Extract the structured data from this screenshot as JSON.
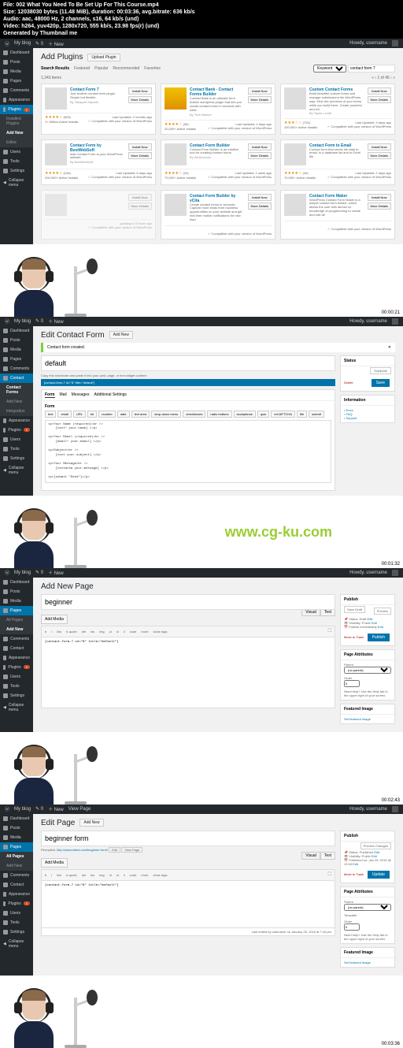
{
  "meta": {
    "line1": "File: 002 What You Need To Be Set Up For This Course.mp4",
    "line2": "Size: 12038030 bytes (11.48 MiB), duration: 00:03:36, avg.bitrate: 636 kb/s",
    "line3": "Audio: aac, 48000 Hz, 2 channels, s16, 64 kb/s (und)",
    "line4": "Video: h264, yuv420p, 1280x720, 555 kb/s, 23.98 fps(r) (und)",
    "line5": "Generated by Thumbnail me"
  },
  "wpbar": {
    "site": "My blog",
    "new": "New",
    "viewpage": "View Page",
    "howdy": "Howdy, username"
  },
  "sidebar_common": {
    "dashboard": "Dashboard",
    "posts": "Posts",
    "media": "Media",
    "pages": "Pages",
    "comments": "Comments",
    "contact": "Contact",
    "appearance": "Appearance",
    "plugins": "Plugins",
    "users": "Users",
    "tools": "Tools",
    "settings": "Settings",
    "collapse": "Collapse menu"
  },
  "sub_plugins": {
    "installed": "Installed Plugins",
    "addnew": "Add New",
    "editor": "Editor"
  },
  "sub_contact": {
    "forms": "Contact Forms",
    "addnew": "Add New",
    "integration": "Integration"
  },
  "sub_pages": {
    "all": "All Pages",
    "addnew": "Add New"
  },
  "sc1": {
    "title": "Add Plugins",
    "upload_btn": "Upload Plugin",
    "tabs": {
      "search": "Search Results",
      "featured": "Featured",
      "popular": "Popular",
      "recommended": "Recommended",
      "favorites": "Favorites"
    },
    "keyword": "Keyword",
    "search_val": "contact form 7",
    "count": "1,343 items",
    "btn_install": "Install Now",
    "btn_details": "More Details",
    "compat_ok": "✓ Compatible with your version of WordPress",
    "plugins": [
      {
        "name": "Contact Form 7",
        "desc": "Just another contact form plugin. Simple but flexible.",
        "auth": "By Takayuki Miyoshi",
        "stars": "★★★★☆",
        "rcount": "(825)",
        "installs": "1+ Million Active Installs",
        "updated": "Last Updated: 2 months ago",
        "thumb": ""
      },
      {
        "name": "Contact Bank - Contact Forms Builder",
        "desc": "Contact Bank is an ultimate form builder wordpress plugin that lets you create contact forms in seconds with ease.",
        "auth": "By Tech Banker",
        "stars": "★★★★☆",
        "rcount": "(96)",
        "installs": "20,000+ Active Installs",
        "updated": "Last Updated: 4 days ago",
        "thumb": "orange"
      },
      {
        "name": "Custom Contact Forms",
        "desc": "Build beautiful custom forms and manage submissions the WordPress way. View live previews of your forms while you build them. Create powerful and exi",
        "auth": "By Taylor Lovett",
        "stars": "★★★☆☆",
        "rcount": "(725)",
        "installs": "100,000+ Active Installs",
        "updated": "Last Updated: 3 days ago",
        "thumb": ""
      },
      {
        "name": "Contact Form by BestWebSoft",
        "desc": "Add Contact Form to your WordPress website.",
        "auth": "By BestWebSoft",
        "stars": "★★★★☆",
        "rcount": "(246)",
        "installs": "200,000+ Active Installs",
        "updated": "Last Updated: 6 days ago",
        "thumb": ""
      },
      {
        "name": "Contact Form Builder",
        "desc": "Contact Form Builder is an intuitive tool for creating contact forms.",
        "auth": "By WebDorado",
        "stars": "★★★★☆",
        "rcount": "(24)",
        "installs": "70,000+ Active Installs",
        "updated": "Last Updated: 1 week ago",
        "thumb": ""
      },
      {
        "name": "Contact Form to Email",
        "desc": "Contact form that sends the data to email, to a database list and to Excel file.",
        "auth": "",
        "stars": "★★★★☆",
        "rcount": "(34)",
        "installs": "70,000+ Active Installs",
        "updated": "Last Updated: 2 days ago",
        "thumb": ""
      },
      {
        "name": "",
        "desc": "",
        "auth": "",
        "stars": "",
        "rcount": "",
        "installs": "",
        "updated": "growing in 5 hours ago",
        "thumb": "",
        "fade": true
      },
      {
        "name": "Contact Form Builder by vCita",
        "desc": "Create contact forms in seconds. Capture more leads from business opportunities on your website and get real time mobile notifications for new lead",
        "auth": "",
        "stars": "",
        "rcount": "",
        "installs": "",
        "updated": "",
        "thumb": ""
      },
      {
        "name": "Contact Form Maker",
        "desc": "WordPress Contact Form Maker is a simple contact form builder, which allows the user with almost no knowledge of programming to create and edit dif",
        "auth": "",
        "stars": "",
        "rcount": "",
        "installs": "",
        "updated": "",
        "thumb": ""
      }
    ],
    "tc": "00:00:21"
  },
  "sc2": {
    "title": "Edit Contact Form",
    "addnew_btn": "Add New",
    "msg": "Contact form created.",
    "form_title": "default",
    "hint": "Copy this shortcode and paste it into your post, page, or text widget content:",
    "shortcode": "[contact-form-7 id=\"8\" title=\"default\"]",
    "tabs": {
      "form": "Form",
      "mail": "Mail",
      "messages": "Messages",
      "addl": "Additional Settings"
    },
    "section_label": "Form",
    "tagbtns": [
      "text",
      "email",
      "URL",
      "tel",
      "number",
      "date",
      "text area",
      "drop-down menu",
      "checkboxes",
      "radio buttons",
      "acceptance",
      "quiz",
      "reCAPTCHA",
      "file",
      "submit"
    ],
    "code": "<p>Your Name (required)<br />\n    [text* your-name] </p>\n\n<p>Your Email (required)<br />\n    [email* your-email] </p>\n\n<p>Subject<br />\n    [text your-subject] </p>\n\n<p>Your Message<br />\n    [textarea your-message] </p>\n\n<p>[submit \"Send\"]</p>",
    "side": {
      "status_h": "Status",
      "dup": "Duplicate",
      "del": "Delete",
      "save": "Save",
      "info_h": "Information",
      "info_items": [
        "Docs",
        "FAQ",
        "Support"
      ]
    },
    "watermark": "www.cg-ku.com",
    "tc": "00:01:32"
  },
  "sc3": {
    "title": "Add New Page",
    "title_val": "beginner",
    "media_btn": "Add Media",
    "vt_visual": "Visual",
    "vt_text": "Text",
    "tb": [
      "b",
      "i",
      "link",
      "b-quote",
      "del",
      "ins",
      "img",
      "ul",
      "ol",
      "li",
      "code",
      "more",
      "close tags"
    ],
    "body": "[contact-form-7 id=\"8\" title=\"default\"]",
    "side": {
      "publish_h": "Publish",
      "save_draft": "Save Draft",
      "preview": "Preview",
      "status": "Status: Draft",
      "edit": "Edit",
      "vis": "Visibility: Public",
      "pub_imm": "Publish immediately",
      "trash": "Move to Trash",
      "publish_btn": "Publish",
      "attrs_h": "Page Attributes",
      "parent": "Parent",
      "parent_v": "(no parent)",
      "order": "Order",
      "order_v": "0",
      "help": "Need help? Use the Help tab in the upper right of your screen.",
      "feat_h": "Featured Image",
      "feat_link": "Set featured image"
    },
    "tc": "00:02:43"
  },
  "sc4": {
    "title": "Edit Page",
    "addnew_btn": "Add New",
    "title_val": "beginner form",
    "perma_label": "Permalink:",
    "perma_url": "http://www.mtest.com/beginner-form/",
    "perma_edit": "Edit",
    "perma_view": "View Page",
    "media_btn": "Add Media",
    "vt_visual": "Visual",
    "vt_text": "Text",
    "tb": [
      "b",
      "i",
      "link",
      "b-quote",
      "del",
      "ins",
      "img",
      "ul",
      "ol",
      "li",
      "code",
      "more",
      "close tags"
    ],
    "body": "[contact-form-7 id=\"8\" title=\"default\"]",
    "revision": "Last edited by username on January 25, 2016 at 7:18 pm",
    "side": {
      "publish_h": "Publish",
      "preview": "Preview Changes",
      "status": "Status: Published",
      "edit": "Edit",
      "vis": "Visibility: Public",
      "pub_on": "Published on: Jan 25, 2016 @ 19:18",
      "trash": "Move to Trash",
      "update_btn": "Update",
      "attrs_h": "Page Attributes",
      "parent": "Parent",
      "parent_v": "(no parent)",
      "template": "Template",
      "order": "Order",
      "order_v": "0",
      "help": "Need help? Use the Help tab in the upper right of your screen.",
      "feat_h": "Featured Image",
      "feat_link": "Set featured image"
    },
    "tc": "00:03:36"
  }
}
